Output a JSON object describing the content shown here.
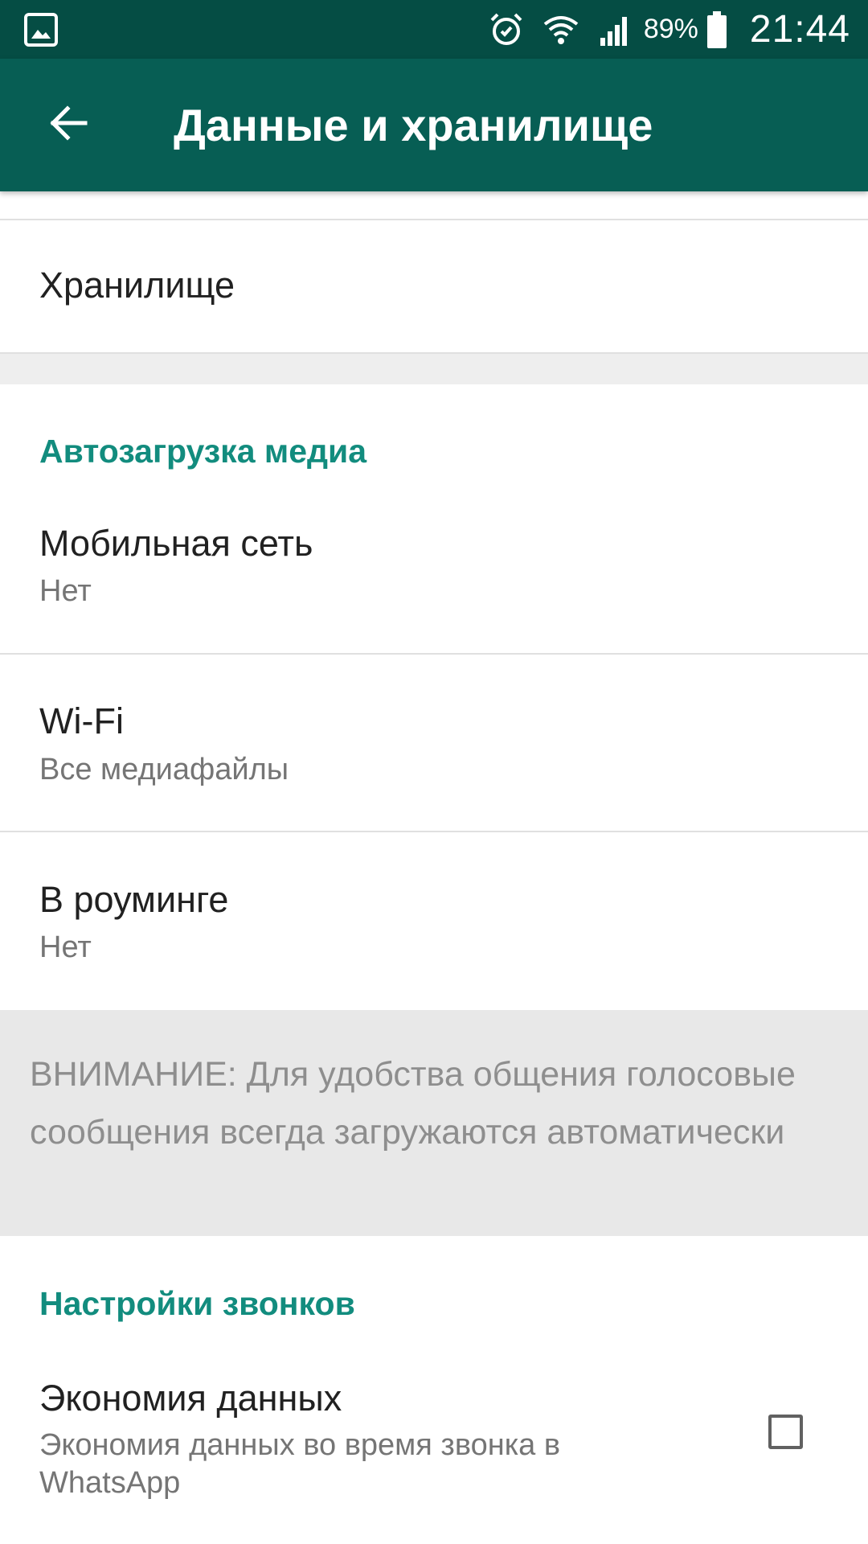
{
  "status_bar": {
    "battery": "89%",
    "time": "21:44",
    "icons": [
      "gallery-icon",
      "alarm-icon",
      "wifi-icon",
      "signal-icon",
      "battery-icon"
    ]
  },
  "app_bar": {
    "title": "Данные и хранилище",
    "back_icon": "arrow-back-icon"
  },
  "storage": {
    "label": "Хранилище"
  },
  "auto_download": {
    "header": "Автозагрузка медиа",
    "items": [
      {
        "label": "Мобильная сеть",
        "value": "Нет"
      },
      {
        "label": "Wi-Fi",
        "value": "Все медиафайлы"
      },
      {
        "label": "В роуминге",
        "value": "Нет"
      }
    ],
    "notice": "ВНИМАНИЕ: Для удобства общения голосовые сообщения всегда загружаются автоматически"
  },
  "call_settings": {
    "header": "Настройки звонков",
    "data_saver": {
      "label": "Экономия данных",
      "description": "Экономия данных во время звонка в WhatsApp",
      "checked": false
    }
  },
  "colors": {
    "status_bar": "#054d44",
    "app_bar": "#075e54",
    "accent": "#128c7e"
  }
}
